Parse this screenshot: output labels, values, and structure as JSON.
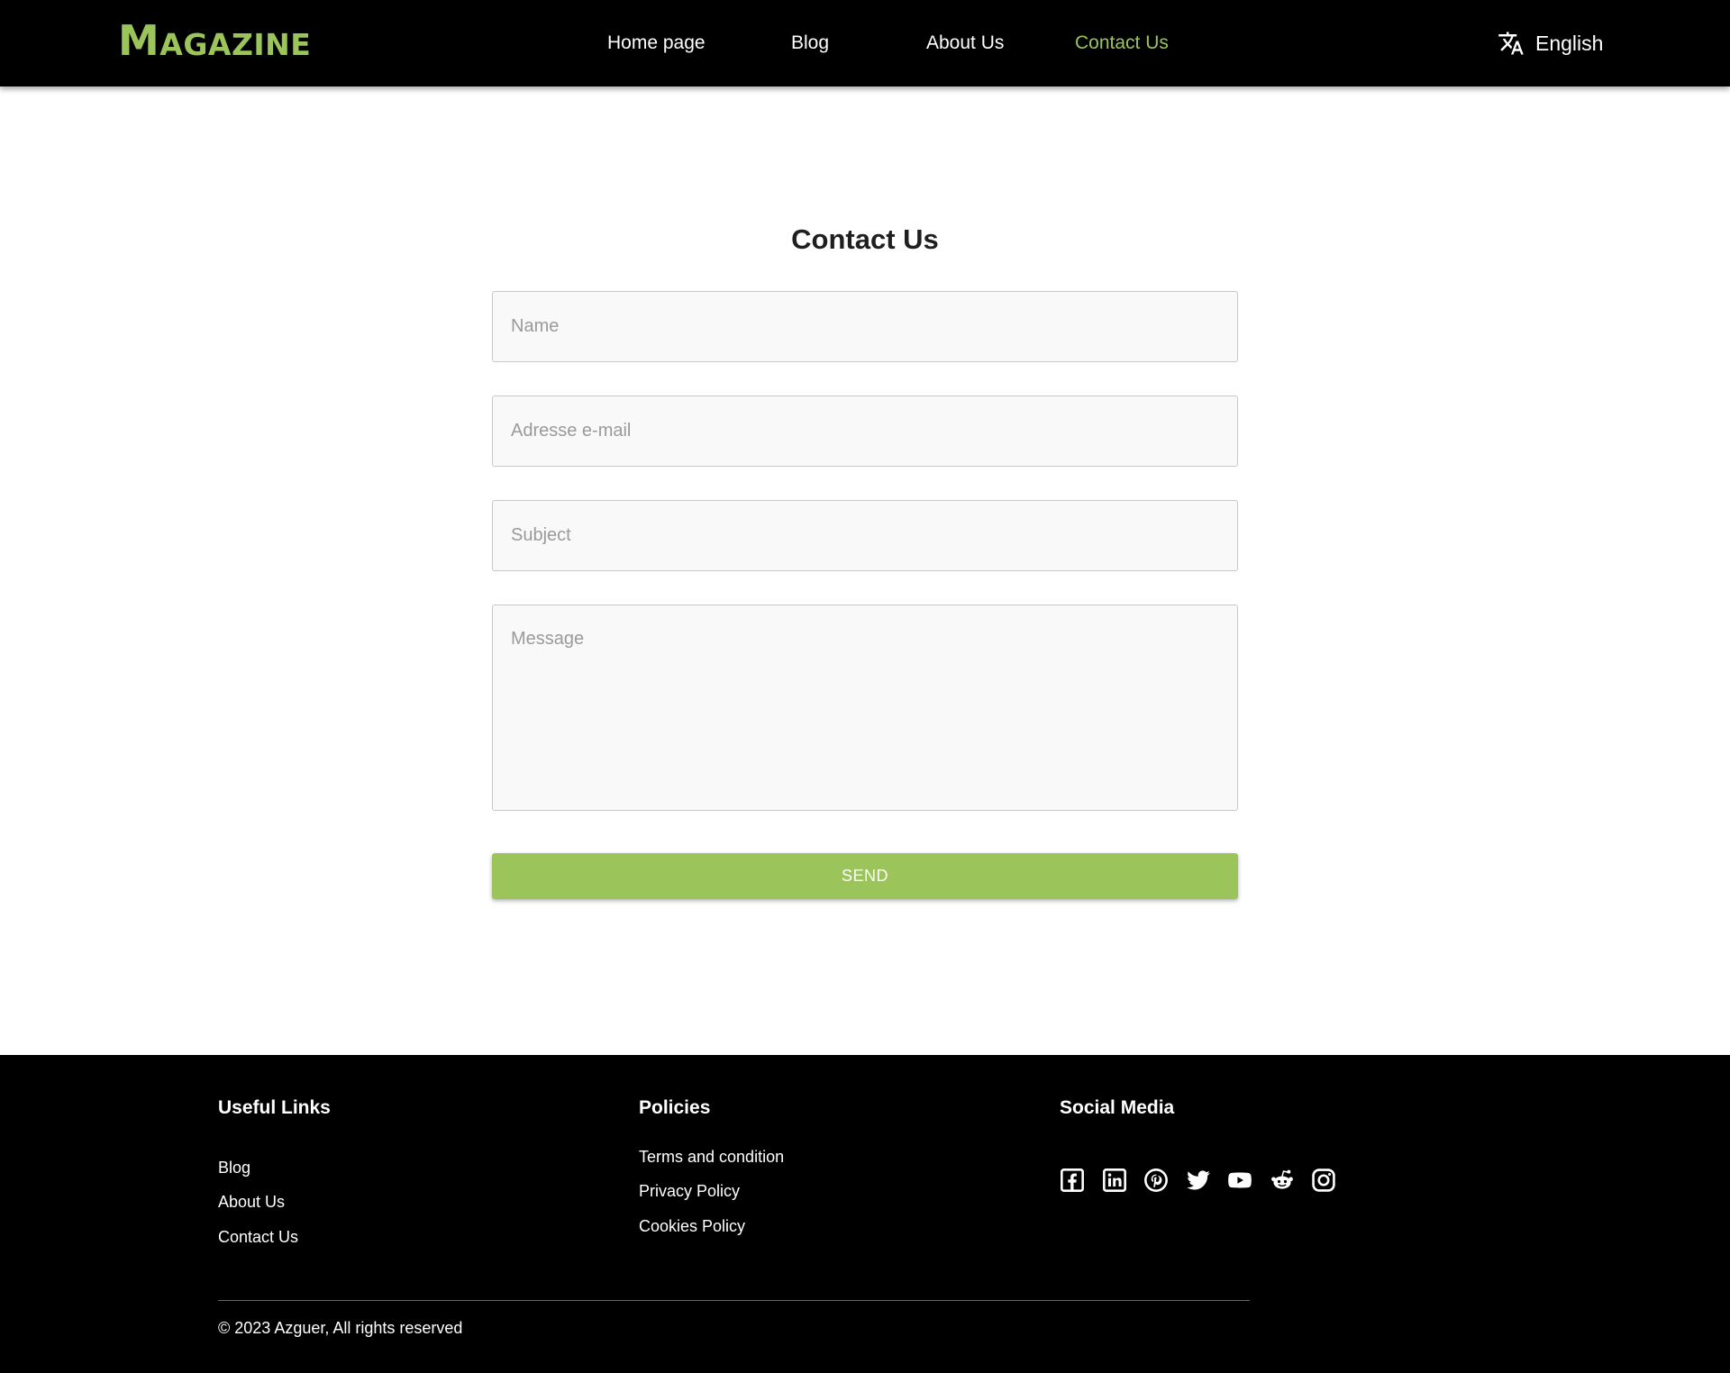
{
  "header": {
    "logo_first": "M",
    "logo_rest": "AGAZINE",
    "nav": [
      {
        "label": "Home page"
      },
      {
        "label": "Blog"
      },
      {
        "label": "About Us"
      },
      {
        "label": "Contact Us",
        "active": true
      }
    ],
    "language": {
      "label": "English",
      "icon": "translate-icon"
    }
  },
  "form": {
    "title": "Contact Us",
    "name_placeholder": "Name",
    "email_placeholder": "Adresse e-mail",
    "subject_placeholder": "Subject",
    "message_placeholder": "Message",
    "send_label": "SEND"
  },
  "footer": {
    "useful_links": {
      "title": "Useful Links",
      "items": [
        "Blog",
        "About Us",
        "Contact Us"
      ]
    },
    "policies": {
      "title": "Policies",
      "items": [
        "Terms and condition",
        "Privacy Policy",
        "Cookies Policy"
      ]
    },
    "social": {
      "title": "Social Media",
      "icons": [
        "facebook-icon",
        "linkedin-icon",
        "pinterest-icon",
        "twitter-icon",
        "youtube-icon",
        "reddit-icon",
        "instagram-icon"
      ]
    },
    "copyright": "© 2023 Azguer, All rights reserved"
  },
  "colors": {
    "accent": "#9bc45a",
    "header_bg": "#000000",
    "footer_bg": "#000000",
    "field_bg": "#f9f9f9"
  }
}
